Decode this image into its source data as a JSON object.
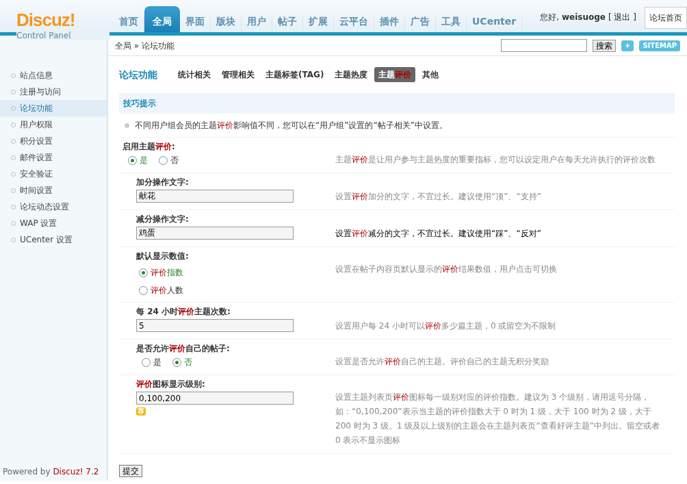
{
  "logo": {
    "name": "Discuz!",
    "subtitle": "Control Panel"
  },
  "nav": [
    {
      "label": "首页",
      "selected": false
    },
    {
      "label": "全局",
      "selected": true
    },
    {
      "label": "界面",
      "selected": false
    },
    {
      "label": "版块",
      "selected": false
    },
    {
      "label": "用户",
      "selected": false
    },
    {
      "label": "帖子",
      "selected": false
    },
    {
      "label": "扩展",
      "selected": false
    },
    {
      "label": "云平台",
      "selected": false
    },
    {
      "label": "插件",
      "selected": false
    },
    {
      "label": "广告",
      "selected": false
    },
    {
      "label": "工具",
      "selected": false
    },
    {
      "label": "UCenter",
      "selected": false
    }
  ],
  "user": {
    "greeting": "您好,",
    "name": "weisuoge",
    "logout": "[ 退出 ]",
    "home": "论坛首页"
  },
  "breadcrumb": "全局 » 论坛功能",
  "search": {
    "button": "搜索",
    "add": "+",
    "sitemap": "SITEMAP"
  },
  "sidebar": [
    {
      "label": "站点信息",
      "selected": false
    },
    {
      "label": "注册与访问",
      "selected": false
    },
    {
      "label": "论坛功能",
      "selected": true
    },
    {
      "label": "用户权限",
      "selected": false
    },
    {
      "label": "积分设置",
      "selected": false
    },
    {
      "label": "邮件设置",
      "selected": false
    },
    {
      "label": "安全验证",
      "selected": false
    },
    {
      "label": "时间设置",
      "selected": false
    },
    {
      "label": "论坛动态设置",
      "selected": false
    },
    {
      "label": "WAP 设置",
      "selected": false
    },
    {
      "label": "UCenter 设置",
      "selected": false
    }
  ],
  "footer": [
    {
      "t": "Powered by "
    },
    {
      "t": "Discuz! 7.2",
      "hl": true
    }
  ],
  "title": "论坛功能",
  "subtabs": [
    {
      "label": [
        {
          "t": "统计相关"
        }
      ],
      "selected": false
    },
    {
      "label": [
        {
          "t": "管理相关"
        }
      ],
      "selected": false
    },
    {
      "label": [
        {
          "t": "主题标签(TAG)"
        }
      ],
      "selected": false
    },
    {
      "label": [
        {
          "t": "主题热度"
        }
      ],
      "selected": false
    },
    {
      "label": [
        {
          "t": "主题"
        },
        {
          "t": "评价",
          "hl": true
        }
      ],
      "selected": true
    },
    {
      "label": [
        {
          "t": "其他"
        }
      ],
      "selected": false
    }
  ],
  "tips": {
    "title": "技巧提示",
    "text": [
      {
        "t": "不同用户组会员的主题"
      },
      {
        "t": "评价",
        "hl": true
      },
      {
        "t": "影响值不同，您可以在“用户组”设置的“帖子相关”中设置。"
      }
    ]
  },
  "settings": [
    {
      "kind": "radio",
      "indent": false,
      "label": [
        {
          "t": "启用主题"
        },
        {
          "t": "评价",
          "hl": true
        },
        {
          "t": ":"
        }
      ],
      "options": [
        {
          "label": [
            {
              "t": "是"
            }
          ],
          "selected": true
        },
        {
          "label": [
            {
              "t": "否"
            }
          ],
          "selected": false
        }
      ],
      "hint": [
        {
          "t": "主题"
        },
        {
          "t": "评价",
          "hl": true
        },
        {
          "t": "是让用户参与主题热度的重要指标，您可以设定用户在每天允许执行的评价次数"
        }
      ],
      "highlighted": false
    },
    {
      "kind": "input",
      "indent": true,
      "label": [
        {
          "t": "加分操作文字:"
        }
      ],
      "value": "献花",
      "hint": [
        {
          "t": "设置"
        },
        {
          "t": "评价",
          "hl": true
        },
        {
          "t": "加分的文字，不宜过长。建议使用“顶”、“支持”"
        }
      ],
      "highlighted": false
    },
    {
      "kind": "input",
      "indent": true,
      "label": [
        {
          "t": "减分操作文字:"
        }
      ],
      "value": "鸡蛋",
      "hint": [
        {
          "t": "设置"
        },
        {
          "t": "评价",
          "hl": true
        },
        {
          "t": "减分的文字，不宜过长。建议使用“踩”、“反对”"
        }
      ],
      "highlighted": true
    },
    {
      "kind": "radio-list",
      "indent": true,
      "label": [
        {
          "t": "默认显示数值:"
        }
      ],
      "options": [
        {
          "label": [
            {
              "t": "评价",
              "hl": true
            },
            {
              "t": "指数"
            }
          ],
          "selected": true
        },
        {
          "label": [
            {
              "t": "评价",
              "hl": true
            },
            {
              "t": "人数"
            }
          ],
          "selected": false
        }
      ],
      "hint": [
        {
          "t": "设置在帖子内容页默认显示的"
        },
        {
          "t": "评价",
          "hl": true
        },
        {
          "t": "结果数值，用户点击可切换"
        }
      ],
      "highlighted": false
    },
    {
      "kind": "input",
      "indent": true,
      "label": [
        {
          "t": "每 24 小时"
        },
        {
          "t": "评价",
          "hl": true
        },
        {
          "t": "主题次数:"
        }
      ],
      "value": "5",
      "hint": [
        {
          "t": "设置用户每 24 小时可以"
        },
        {
          "t": "评价",
          "hl": true
        },
        {
          "t": "多少篇主题，0 或留空为不限制"
        }
      ],
      "highlighted": false
    },
    {
      "kind": "radio",
      "indent": true,
      "label": [
        {
          "t": "是否允许"
        },
        {
          "t": "评价",
          "hl": true
        },
        {
          "t": "自己的帖子:"
        }
      ],
      "options": [
        {
          "label": [
            {
              "t": "是"
            }
          ],
          "selected": false
        },
        {
          "label": [
            {
              "t": "否"
            }
          ],
          "selected": true
        }
      ],
      "hint": [
        {
          "t": "设置是否允许"
        },
        {
          "t": "评价",
          "hl": true
        },
        {
          "t": "自己的主题。评价自己的主题无积分奖励"
        }
      ],
      "highlighted": false
    },
    {
      "kind": "input",
      "indent": true,
      "label": [
        {
          "t": "评价",
          "hl": true
        },
        {
          "t": "图标显示级别:"
        }
      ],
      "value": "0,100,200",
      "badge": "荐",
      "hint": [
        {
          "t": "设置主题列表页"
        },
        {
          "t": "评价",
          "hl": true
        },
        {
          "t": "图标每一级别对应的评价指数。建议为 3 个级别，请用逗号分隔，如：“0,100,200”表示当主题的评价指数大于 0 时为 1 级，大于 100 时为 2 级，大于 200 时为 3 级。1 级及以上级别的主题会在主题列表页“查看好评主题”中列出。留空或者 0 表示不显示图标"
        }
      ],
      "highlighted": false
    }
  ],
  "submit": "提交"
}
